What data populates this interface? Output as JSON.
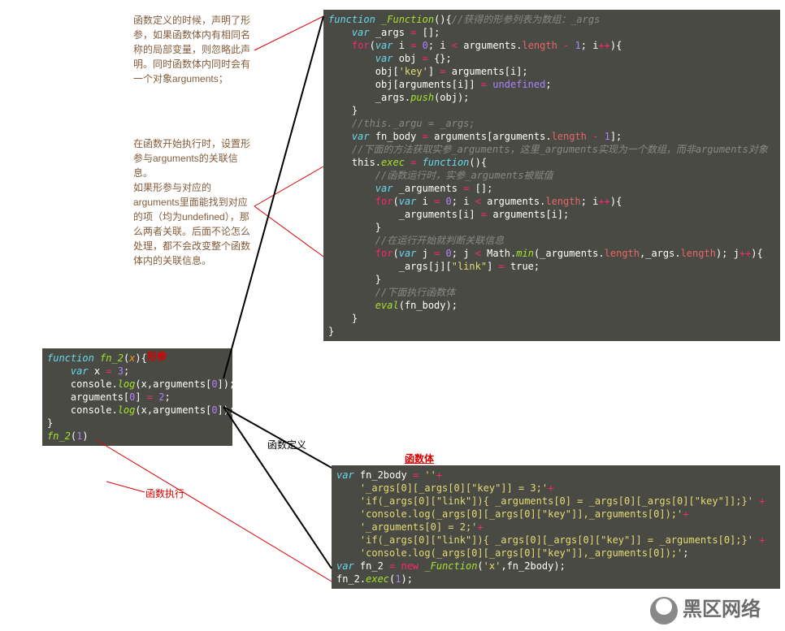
{
  "note1": "函数定义的时候，声明了形参，如果函数体内有相同名称的局部变量，则忽略此声明。同时函数体内同时会有一个对象arguments；",
  "note2": "在函数开始执行时，设置形参与arguments的关联信息。\n如果形参与对应的arguments里面能找到对应的项（均为undefined），那么两者关联。后面不论怎么处理，都不会改变整个函数体内的关联信息。",
  "label_param": "形参",
  "label_define": "函数定义",
  "label_body": "函数体",
  "label_exec": "函数执行",
  "logo": "黑区网络",
  "code1": {
    "l1a": "function ",
    "l1b": "_Function",
    "l1c": "(){",
    "l1d": "//获得的形参列表为数组：_args",
    "l2a": "var ",
    "l2b": "_args ",
    "l2c": "= ",
    "l2d": "[];",
    "l3a": "for",
    "l3b": "(",
    "l3c": "var ",
    "l3d": "i ",
    "l3e": "= ",
    "l3f": "0",
    "l3g": "; i ",
    "l3h": "< ",
    "l3i": "arguments.",
    "l3j": "length ",
    "l3k": "- ",
    "l3l": "1",
    "l3m": "; i",
    "l3n": "++",
    "l3o": "){",
    "l4a": "var ",
    "l4b": "obj ",
    "l4c": "= ",
    "l4d": "{};",
    "l5a": "obj[",
    "l5b": "'key'",
    "l5c": "] ",
    "l5d": "= ",
    "l5e": "arguments[i];",
    "l6a": "obj[arguments[i]] ",
    "l6b": "= ",
    "l6c": "undefined",
    "l6d": ";",
    "l7a": "_args.",
    "l7b": "push",
    "l7c": "(obj);",
    "l8": "}",
    "l9": "//this._argu = _args;",
    "l10a": "var ",
    "l10b": "fn_body ",
    "l10c": "= ",
    "l10d": "arguments[arguments.",
    "l10e": "length ",
    "l10f": "- ",
    "l10g": "1",
    "l10h": "];",
    "l11": "//下面的方法获取实参_arguments，这里_arguments实现为一个数组，而非arguments对象",
    "l12a": "this.",
    "l12b": "exec ",
    "l12c": "= ",
    "l12d": "function",
    "l12e": "(){",
    "l13": "//函数运行时，实参_arguments被赋值",
    "l14a": "var ",
    "l14b": "_arguments ",
    "l14c": "= ",
    "l14d": "[];",
    "l15a": "for",
    "l15b": "(",
    "l15c": "var ",
    "l15d": "i ",
    "l15e": "= ",
    "l15f": "0",
    "l15g": "; i ",
    "l15h": "< ",
    "l15i": "arguments.",
    "l15j": "length",
    "l15k": "; i",
    "l15l": "++",
    "l15m": "){",
    "l16a": "_arguments[i] ",
    "l16b": "= ",
    "l16c": "arguments[i];",
    "l17": "}",
    "l18": "//在运行开始就判断关联信息",
    "l19a": "for",
    "l19b": "(",
    "l19c": "var ",
    "l19d": "j ",
    "l19e": "= ",
    "l19f": "0",
    "l19g": "; j ",
    "l19h": "< ",
    "l19i": "Math.",
    "l19j": "min",
    "l19k": "(_arguments.",
    "l19l": "length",
    "l19m": ",_args.",
    "l19n": "length",
    "l19o": "); j",
    "l19p": "++",
    "l19q": "){",
    "l20a": "_args[j][",
    "l20b": "\"link\"",
    "l20c": "] ",
    "l20d": "= ",
    "l20e": "true;",
    "l21": "}",
    "l22": "//下面执行函数体",
    "l23a": "eval",
    "l23b": "(fn_body);",
    "l24": "}",
    "l25": "}"
  },
  "code2": {
    "l1a": "function ",
    "l1b": "fn_2",
    "l1c": "(",
    "l1d": "x",
    "l1e": "){",
    "l2a": "var ",
    "l2b": "x ",
    "l2c": "= ",
    "l2d": "3",
    "l2e": ";",
    "l3a": "console.",
    "l3b": "log",
    "l3c": "(x,arguments[",
    "l3d": "0",
    "l3e": "]);",
    "l4a": "arguments[",
    "l4b": "0",
    "l4c": "] ",
    "l4d": "= ",
    "l4e": "2",
    "l4f": ";",
    "l5a": "console.",
    "l5b": "log",
    "l5c": "(x,arguments[",
    "l5d": "0",
    "l5e": "]);",
    "l6": "}",
    "l7a": "fn_2",
    "l7b": "(",
    "l7c": "1",
    "l7d": ")"
  },
  "code3": {
    "l1a": "var ",
    "l1b": "fn_2body ",
    "l1c": "= ",
    "l1d": "''",
    "l1e": "+",
    "l2a": "'_args[0][_args[0][\"key\"]] = 3;'",
    "l2b": "+",
    "l3a": "'if(_args[0][\"link\"]){ _arguments[0] = _args[0][_args[0][\"key\"]];}' ",
    "l3b": "+",
    "l4a": "'console.log(_args[0][_args[0][\"key\"]],_arguments[0]);'",
    "l4b": "+",
    "l5a": "'_arguments[0] = 2;'",
    "l5b": "+",
    "l6a": "'if(_args[0][\"link\"]){ _args[0][_args[0][\"key\"]] = _arguments[0];}' ",
    "l6b": "+",
    "l7a": "'console.log(_args[0][_args[0][\"key\"]],_arguments[0]);'",
    "l7b": ";",
    "l8a": "var ",
    "l8b": "fn_2 ",
    "l8c": "= ",
    "l8d": "new ",
    "l8e": "_Function",
    "l8f": "(",
    "l8g": "'x'",
    "l8h": ",fn_2body);",
    "l9a": "fn_2.",
    "l9b": "exec",
    "l9c": "(",
    "l9d": "1",
    "l9e": ");"
  }
}
